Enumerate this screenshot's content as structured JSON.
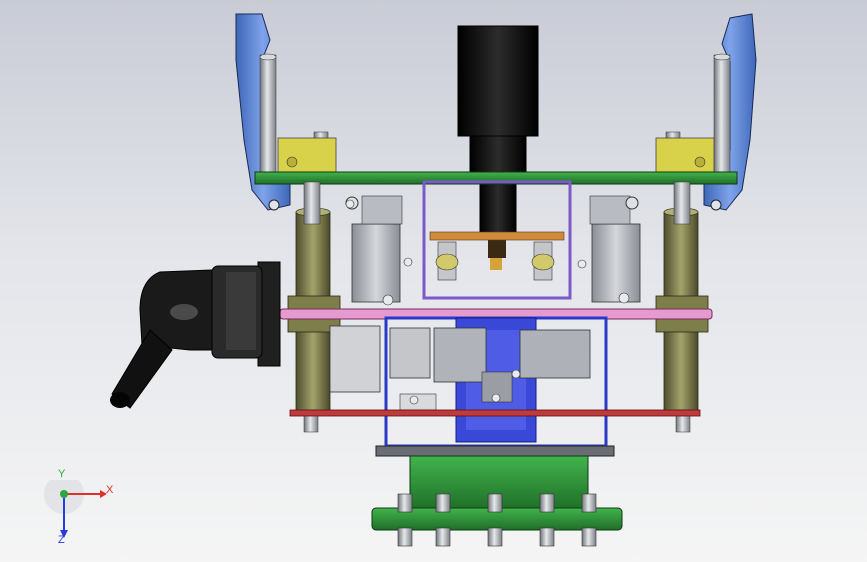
{
  "viewport": {
    "background_top": "#c9ccd6",
    "background_bottom": "#f5f5f5"
  },
  "model": {
    "colors": {
      "blue_bracket": "#5b86d6",
      "yellow_block": "#d8d24a",
      "green_plate": "#2e8f3a",
      "green_flange": "#2f9a3a",
      "pink_plate": "#e59bd0",
      "red_plate": "#c0393b",
      "dark_blue_frame": "#2a39c8",
      "purple_frame": "#7a5ac8",
      "orange_bar": "#d08a3c",
      "olive_column": "#8a8a50",
      "grey_metal": "#a8acb2",
      "black_motor": "#141414"
    },
    "parts": [
      "left-blue-bracket",
      "right-blue-bracket",
      "top-green-plate",
      "black-motor",
      "left-olive-column",
      "right-olive-column",
      "pink-plate",
      "red-plate",
      "blue-frame",
      "purple-frame",
      "green-base-flange",
      "connector-assembly"
    ]
  },
  "triad": {
    "x_label": "X",
    "y_label": "Y",
    "z_label": "Z",
    "x_color": "#e0302a",
    "y_color": "#2aa83a",
    "z_color": "#2a3ae0"
  }
}
